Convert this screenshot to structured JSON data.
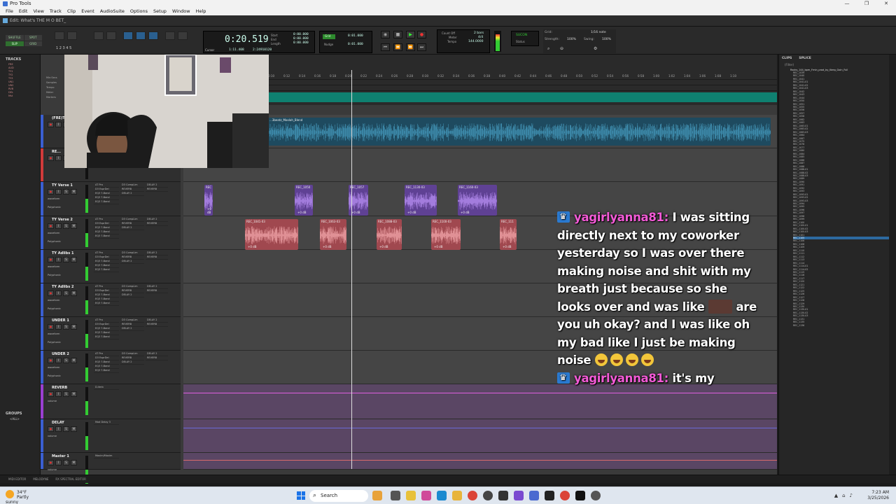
{
  "os": {
    "title": "Pro Tools",
    "controls": [
      "—",
      "❐",
      "✕"
    ],
    "menu": [
      "File",
      "Edit",
      "View",
      "Track",
      "Clip",
      "Event",
      "AudioSuite",
      "Options",
      "Setup",
      "Window",
      "Help"
    ]
  },
  "edit_window": {
    "title": "Edit: What's THE M O BET_"
  },
  "toolbar": {
    "modes": [
      "SHUFFLE",
      "SPOT",
      "SLIP",
      "GRID"
    ],
    "zoom_presets": "1 2 3 4 5",
    "counter": {
      "main": "0:20.519",
      "labels": [
        "Start",
        "End",
        "Length"
      ],
      "values": [
        "0:00.000",
        "0:00.000",
        "0:00.000"
      ],
      "cursor_label": "Cursor",
      "cursor_value": "1:11.408",
      "extra": "2:24910120"
    },
    "nudge": {
      "grid_label": "Grid",
      "grid_value": "0:01.000",
      "nudge_label": "Nudge",
      "nudge_value": "0:01.000"
    },
    "midi": {
      "count_off": "Count Off",
      "bars": "2 bars",
      "meter_label": "Meter",
      "meter": "4/4",
      "tempo_label": "Tempo",
      "tempo": "144.0000"
    },
    "sync": {
      "label": "SUCON",
      "status": "Status"
    },
    "grid": {
      "grid_label": "Grid:",
      "grid_value": "1/16 note",
      "strength_label": "Strength:",
      "strength": "100%",
      "swing_label": "Swing:",
      "swing": "100%"
    }
  },
  "tracks_panel": {
    "header": "TRACKS",
    "items": [
      "FRE",
      "AUD",
      "TY1",
      "TY2",
      "TY3",
      "UN1",
      "UN2",
      "RVB",
      "DEL",
      "Mst"
    ],
    "groups_header": "GROUPS",
    "groups_all": "<ALL>"
  },
  "rulers": {
    "labels": [
      "Min:Secs",
      "Samples",
      "Tempo",
      "Meter",
      "Markers"
    ],
    "ticks": [
      "0:10",
      "0:12",
      "0:14",
      "0:16",
      "0:18",
      "0:20",
      "0:22",
      "0:24",
      "0:26",
      "0:28",
      "0:30",
      "0:32",
      "0:34",
      "0:36",
      "0:38",
      "0:40",
      "0:42",
      "0:44",
      "0:46",
      "0:48",
      "0:50",
      "0:52",
      "0:54",
      "0:56",
      "0:58",
      "1:00",
      "1:02",
      "1:04",
      "1:06",
      "1:08",
      "1:10"
    ]
  },
  "tracks": [
    {
      "name": "(FRE)TA...",
      "color": "#3a5fd1",
      "clips": [
        {
          "name": "...3beatz_Moolah_Blend",
          "type": "teal"
        }
      ]
    },
    {
      "name": "RE...",
      "color": "#d03a3a",
      "clips": []
    },
    {
      "name": "TY Verse 1",
      "color": "#3a5fd1",
      "mode": "waveform",
      "plugin": "Polyphonic",
      "inserts": [
        "AT Pro",
        "D3 EsprDel",
        "EQ3 7-Band",
        "EQ3 7-Band",
        "EQ3 7-Band"
      ],
      "sends": [
        "D3 CompLim",
        "REVERB",
        "DELAY 2"
      ],
      "io": [
        "DELAY 2",
        "REVERB"
      ],
      "clips": [
        {
          "name": "REC",
          "type": "purple"
        },
        {
          "name": "REC_1050",
          "type": "purple"
        },
        {
          "name": "REC_1057",
          "type": "purple"
        },
        {
          "name": "REC_1130-03",
          "type": "purple"
        },
        {
          "name": "REC_1160-03",
          "type": "purple"
        }
      ]
    },
    {
      "name": "TY Verse 2",
      "color": "#3a5fd1",
      "mode": "waveform",
      "plugin": "Polyphonic",
      "inserts": [
        "AT Pro",
        "D3 EsprDel",
        "EQ3 7-Band",
        "EQ3 7-Band",
        "EQ3 7-Band"
      ],
      "sends": [
        "D3 CompLim",
        "REVERB",
        "DELAY 2"
      ],
      "io": [
        "DELAY 2",
        "REVERB"
      ],
      "clips": [
        {
          "name": "REC_1041-03",
          "type": "red"
        },
        {
          "name": "REC_1063-03",
          "type": "red"
        },
        {
          "name": "REC_1088-03",
          "type": "red"
        },
        {
          "name": "REC_1100-03",
          "type": "red"
        },
        {
          "name": "REC_111",
          "type": "red"
        }
      ]
    },
    {
      "name": "TY Adlibs 1",
      "color": "#3a5fd1",
      "mode": "waveform",
      "plugin": "Polyphonic",
      "inserts": [
        "AT Pro",
        "D3 EsprDel",
        "EQ3 7-Band",
        "EQ3 7-Band",
        "EQ3 7-Band"
      ],
      "sends": [
        "D3 CompLim",
        "REVERB",
        "DELAY 2"
      ],
      "io": [
        "DELAY 2",
        "REVERB"
      ],
      "clips": []
    },
    {
      "name": "TY Adlibs 2",
      "color": "#3a5fd1",
      "mode": "waveform",
      "plugin": "Polyphonic",
      "inserts": [
        "AT Pro",
        "D3 EsprDel",
        "EQ3 7-Band",
        "EQ3 7-Band",
        "EQ3 7-Band"
      ],
      "sends": [
        "D3 CompLim",
        "REVERB",
        "DELAY 2"
      ],
      "io": [
        "DELAY 2",
        "REVERB"
      ],
      "clips": []
    },
    {
      "name": "UNDER 1",
      "color": "#3a5fd1",
      "mode": "waveform",
      "plugin": "Polyphonic",
      "inserts": [
        "AT Pro",
        "D3 EsprDel",
        "EQ3 7-Band",
        "EQ3 7-Band",
        "EQ3 7-Band"
      ],
      "sends": [
        "D3 CompLim",
        "REVERB",
        "DELAY 2"
      ],
      "io": [
        "DELAY 2",
        "REVERB"
      ],
      "clips": []
    },
    {
      "name": "UNDER 2",
      "color": "#3a5fd1",
      "mode": "waveform",
      "plugin": "Polyphonic",
      "inserts": [
        "AT Pro",
        "D3 EsprDel",
        "EQ3 7-Band",
        "EQ3 7-Band",
        "EQ3 7-Band"
      ],
      "sends": [
        "D3 CompLim",
        "REVERB",
        "DELAY 2"
      ],
      "io": [
        "DELAY 2",
        "REVERB"
      ],
      "clips": []
    },
    {
      "name": "REVERB",
      "color": "#9a3fd1",
      "mode": "volume",
      "inserts": [
        "D-Verb"
      ],
      "clips": []
    },
    {
      "name": "DELAY",
      "color": "#3a5fd1",
      "mode": "volume",
      "inserts": [
        "Mod Delay 3"
      ],
      "clips": []
    },
    {
      "name": "Master 1",
      "color": "#3a5fd1",
      "mode": "volume",
      "inserts": [
        "Maxim/Maxim"
      ],
      "clips": []
    }
  ],
  "chat": {
    "messages": [
      {
        "user": "yagirlyanna81:",
        "parts": [
          {
            "t": "text",
            "v": "I was sitting directly next to my coworker yesterday so I was over there making noise and shit with my breath just because so she looks over and was like "
          },
          {
            "t": "emote",
            "v": "emote"
          },
          {
            "t": "text",
            "v": " are you uh okay? and I was like oh my bad like I just be making noise "
          }
        ],
        "emojis": [
          "😂",
          "😂",
          "😂",
          "😂"
        ]
      },
      {
        "user": "yagirlyanna81:",
        "parts": [
          {
            "t": "text",
            "v": "it's my"
          }
        ],
        "emojis": []
      }
    ]
  },
  "clips_panel": {
    "tabs": [
      "CLIPS",
      "SPLICE"
    ],
    "filter": "(Filter)",
    "root": "Racks_144_bpm_Fmin_prod_by_Keep_Goin_Full",
    "items": [
      "REC_1039",
      "REC_1040",
      "REC_1041",
      "REC_1041-01",
      "REC_1041-02",
      "REC_1041-03",
      "REC_1042",
      "REC_1043",
      "REC_1044",
      "REC_1050",
      "REC_1051",
      "REC_1055",
      "REC_1056",
      "REC_1057",
      "REC_1058",
      "REC_1062",
      "REC_1063",
      "REC_1063-01",
      "REC_1063-02",
      "REC_1063-03",
      "REC_1064",
      "REC_1067",
      "REC_1075",
      "REC_1076",
      "REC_1077",
      "REC_1080",
      "REC_1084",
      "REC_1085",
      "REC_1086",
      "REC_1087",
      "REC_1088",
      "REC_1088-01",
      "REC_1088-02",
      "REC_1088-03",
      "REC_1089",
      "REC_1090",
      "REC_1091",
      "REC_1092",
      "REC_1093",
      "REC_1093-01",
      "REC_1093-02",
      "REC_1093-03",
      "REC_1094",
      "REC_1095",
      "REC_1096",
      "REC_1097",
      "REC_1098",
      "REC_1099",
      "REC_1100",
      "REC_1100-01",
      "REC_1100-02",
      "REC_1100-03",
      "REC_1101",
      "REC_1105",
      "REC_1106",
      "REC_1108",
      "REC_1109",
      "REC_1110",
      "REC_1111",
      "REC_1112",
      "REC_1113",
      "REC_1114",
      "REC_1114-01",
      "REC_1114-02",
      "REC_1115",
      "REC_1116",
      "REC_1117",
      "REC_1120",
      "REC_1121",
      "REC_1122",
      "REC_1125",
      "REC_1126",
      "REC_1127",
      "REC_1128",
      "REC_1129",
      "REC_1130",
      "REC_1130-01",
      "REC_1130-02",
      "REC_1130-03",
      "REC_1131",
      "REC_1135",
      "REC_1136"
    ],
    "selected_index": 53
  },
  "bottom_bar": [
    "MIDI EDITOR",
    "MELODYNE",
    "RX SPECTRAL EDITOR"
  ],
  "taskbar": {
    "weather_temp": "34°F",
    "weather_desc": "Partly sunny",
    "search": "Search",
    "time": "7:23 AM",
    "date": "3/25/2026"
  }
}
